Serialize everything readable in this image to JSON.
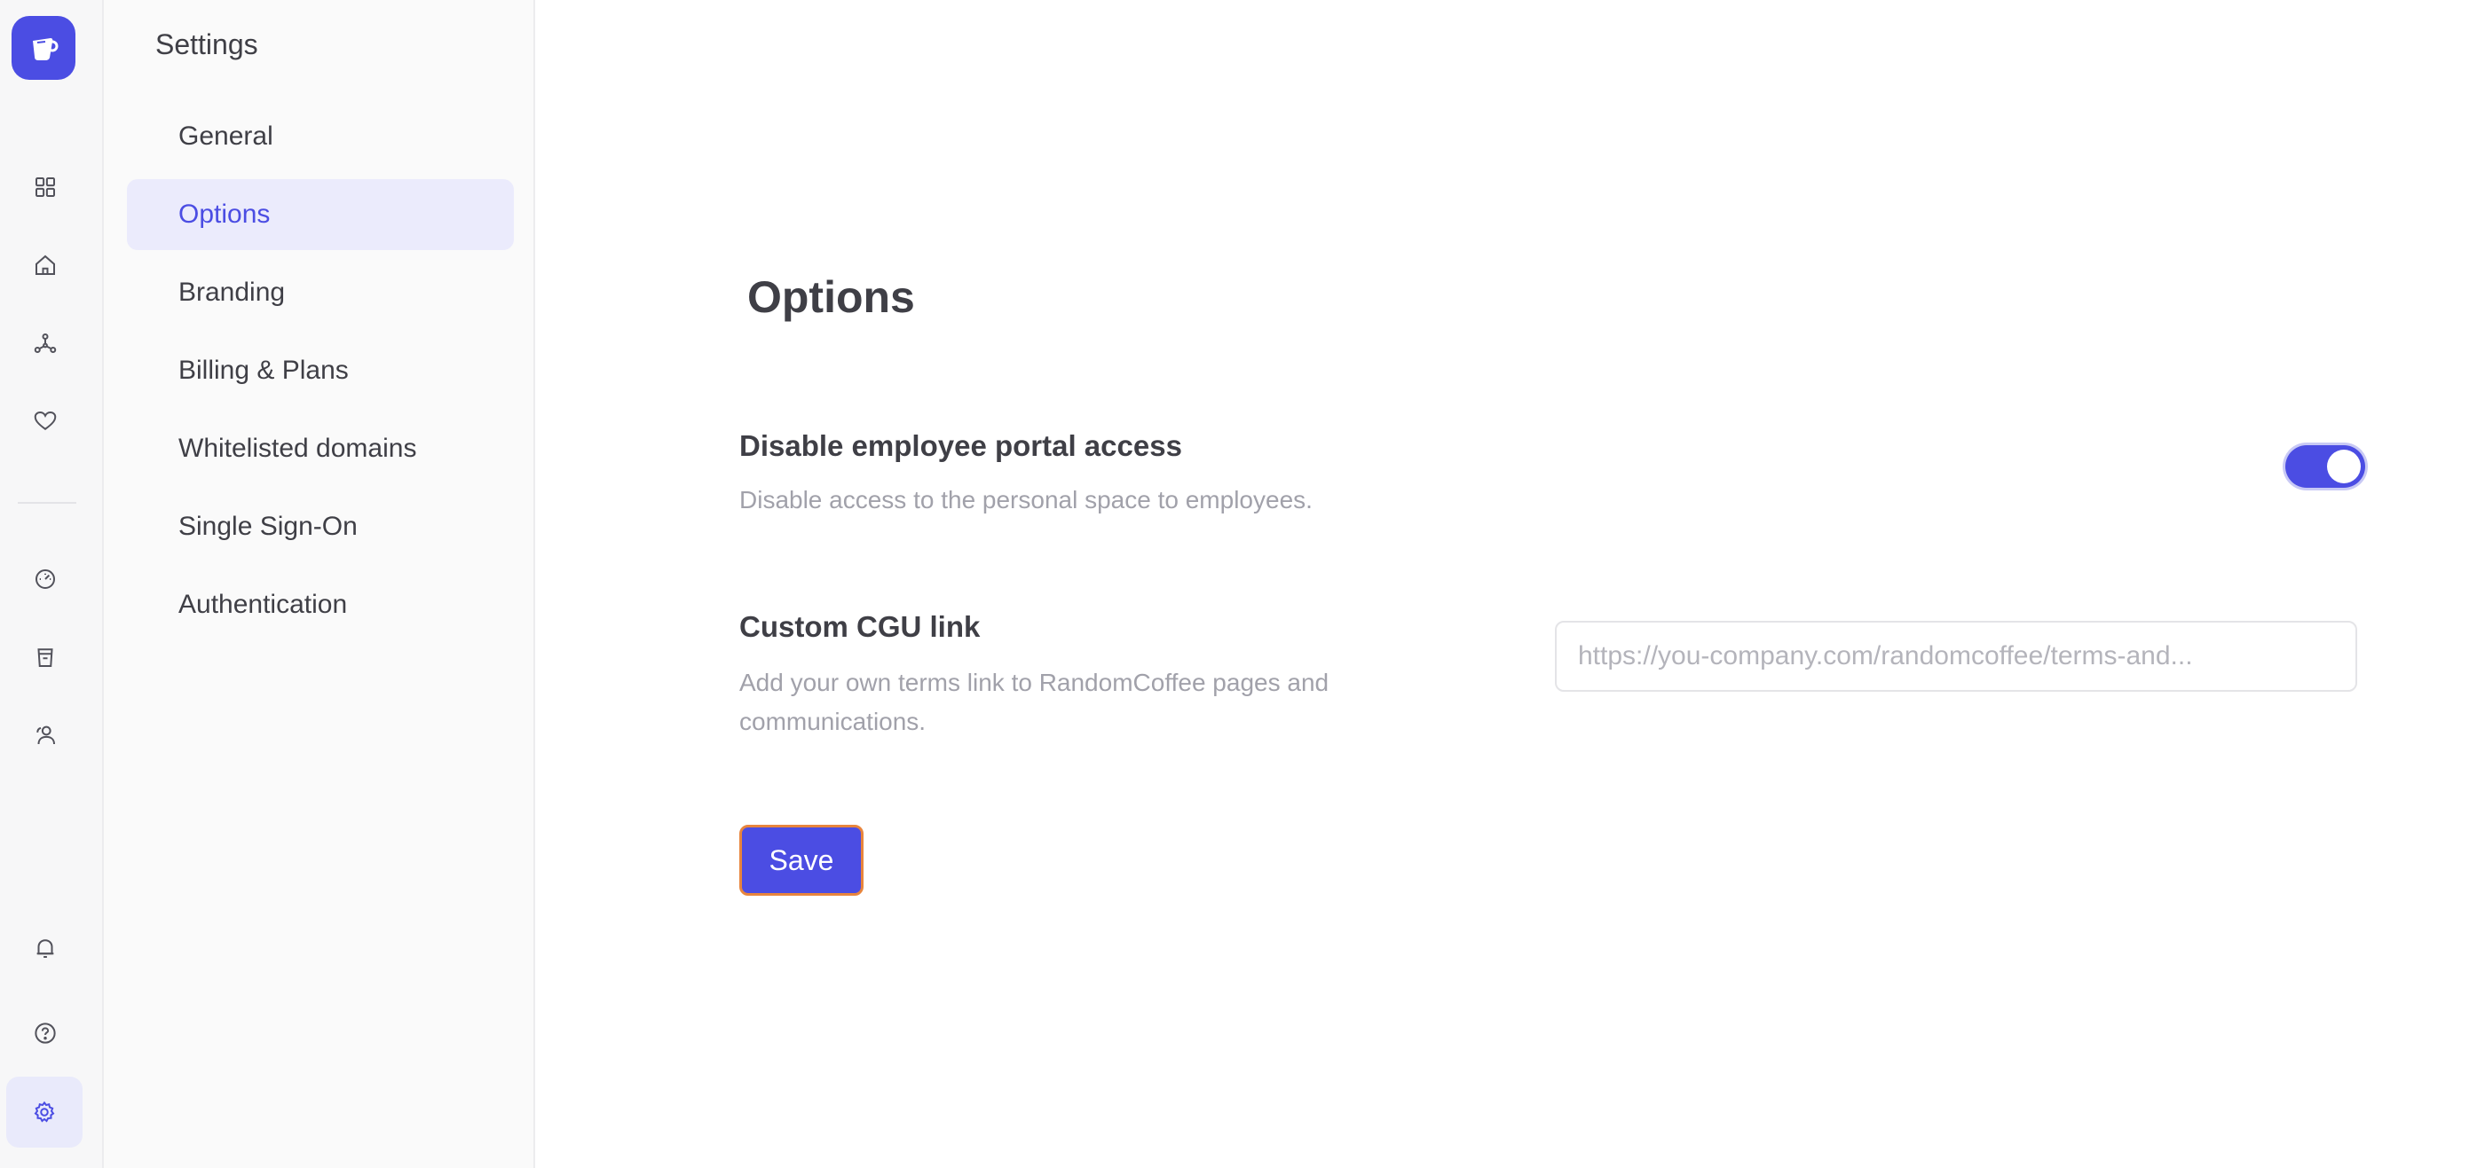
{
  "colors": {
    "accent": "#4b4de3",
    "focus_ring": "#e8853d",
    "muted_text": "#a1a1aa"
  },
  "rail": {
    "logo_icon": "coffee-cup-logo",
    "top_icons": [
      "grid-icon",
      "home-icon",
      "network-icon",
      "heart-icon"
    ],
    "middle_icons": [
      "gauge-icon",
      "cup-icon",
      "people-icon"
    ],
    "bottom_icons": [
      "bell-icon",
      "help-icon",
      "gear-icon"
    ],
    "active": "gear-icon"
  },
  "sidebar": {
    "title": "Settings",
    "items": [
      {
        "label": "General"
      },
      {
        "label": "Options"
      },
      {
        "label": "Branding"
      },
      {
        "label": "Billing & Plans"
      },
      {
        "label": "Whitelisted domains"
      },
      {
        "label": "Single Sign-On"
      },
      {
        "label": "Authentication"
      }
    ],
    "active_item": "Options"
  },
  "main": {
    "title": "Options",
    "portal": {
      "title": "Disable employee portal access",
      "description": "Disable access to the personal space to employees.",
      "enabled": true
    },
    "cgu": {
      "title": "Custom CGU link",
      "description_line1": "Add your own terms link to RandomCoffee pages and",
      "description_line2": "communications.",
      "value": "",
      "placeholder": "https://you-company.com/randomcoffee/terms-and..."
    },
    "save_label": "Save"
  }
}
